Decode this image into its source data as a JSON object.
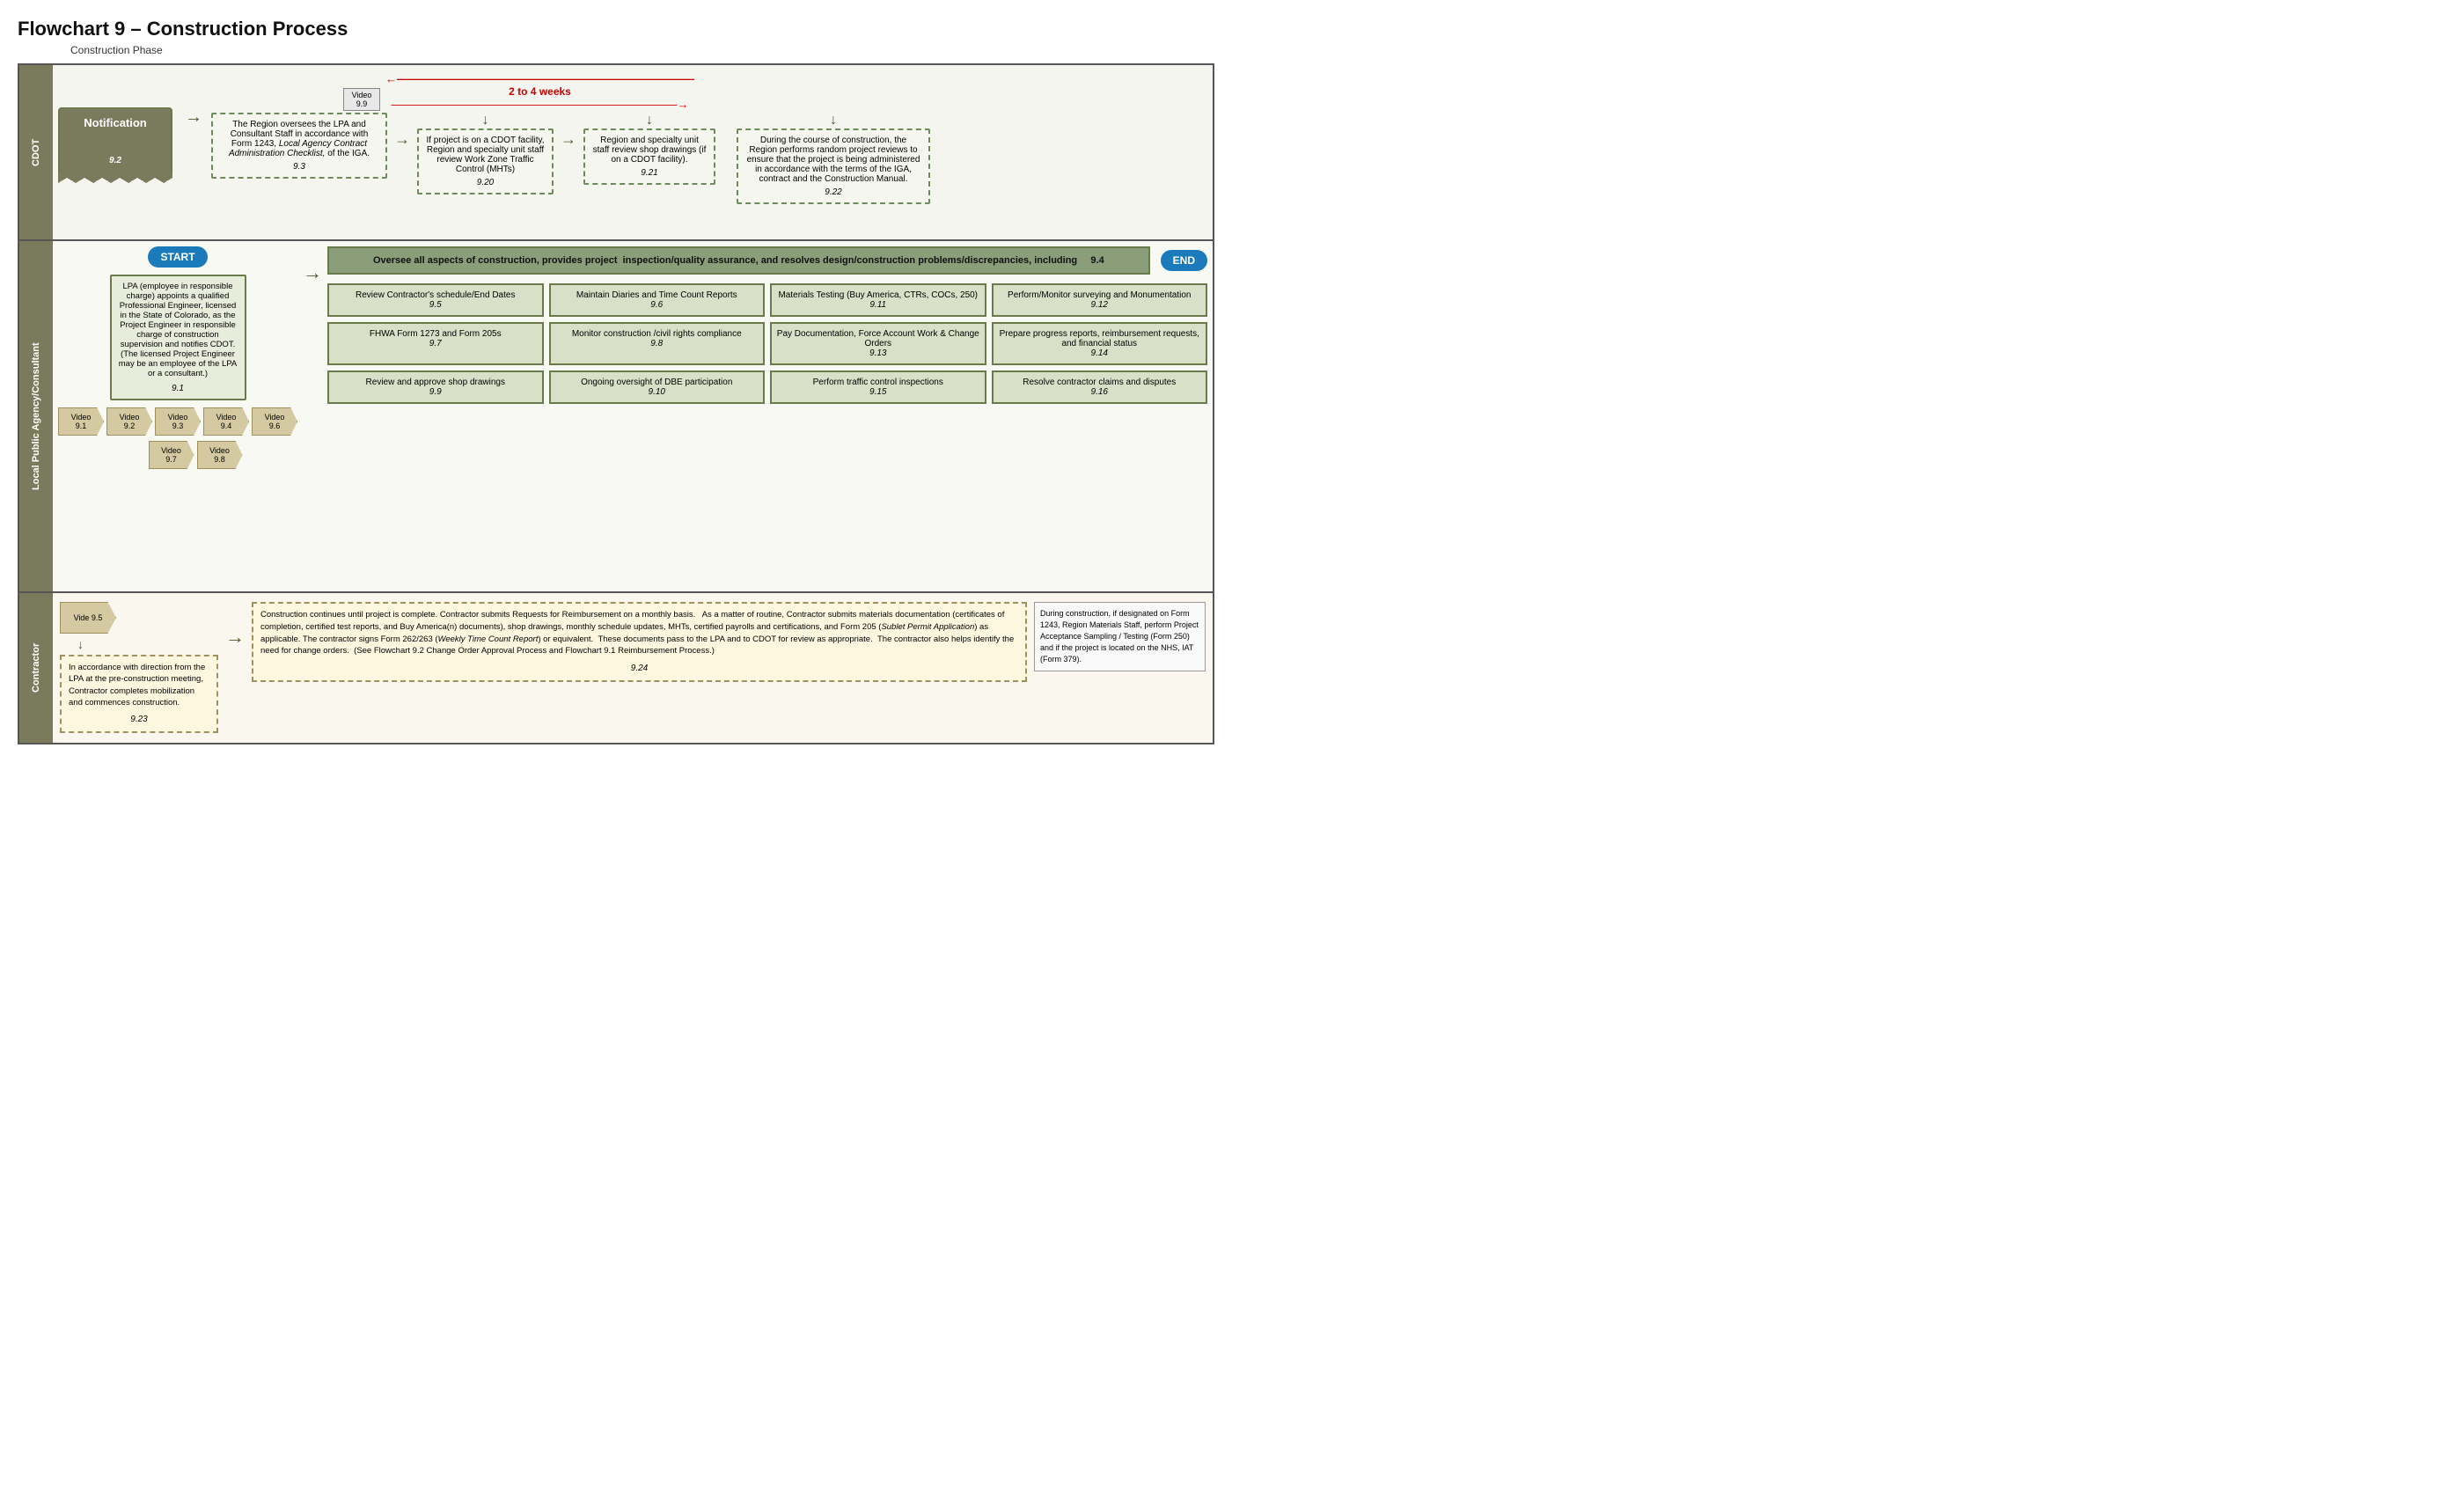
{
  "title": "Flowchart 9 – Construction Process",
  "phase": "Construction Phase",
  "rows": {
    "cdot": {
      "label": "CDOT",
      "notification": {
        "title": "Notification",
        "number": "9.2"
      },
      "video_top": "Video\n9.9",
      "weeks_label": "2 to 4 weeks",
      "box_93": {
        "text": "The Region oversees the LPA and Consultant Staff in accordance with Form 1243, Local Agency Contract Administration Checklist, of the IGA.",
        "number": "9.3",
        "italic_part": "Local Agency Contract Administration Checklist,"
      },
      "box_920": {
        "text": "If project is on a CDOT facility, Region and specialty unit staff review Work Zone Traffic Control (MHTs)",
        "number": "9.20"
      },
      "box_921": {
        "text": "Region and specialty unit staff review shop drawings (if on a CDOT facility).",
        "number": "9.21"
      },
      "box_922": {
        "text": "During the course of construction, the Region performs random project reviews to ensure that the project is being administered in accordance with the terms of the IGA, contract and the Construction Manual.",
        "number": "9.22"
      }
    },
    "lpa": {
      "label": "Local Public Agency/Consultant",
      "start_label": "START",
      "end_label": "END",
      "box_91": {
        "text": "LPA (employee in responsible charge) appoints a qualified Professional Engineer, licensed in the State of Colorado, as the Project Engineer in responsible charge of construction supervision and notifies CDOT.\n(The licensed Project Engineer may be an employee of the LPA or a consultant.)",
        "number": "9.1"
      },
      "videos_left": [
        "Video\n9.1",
        "Video\n9.2",
        "Video\n9.3",
        "Video\n9.4",
        "Video\n9.6"
      ],
      "videos_second_row": [
        "Video\n9.7",
        "Video\n9.8"
      ],
      "oversee_bar": {
        "text": "Oversee all aspects of construction, provides project  inspection/quality assurance, and resolves design/construction problems/discrepancies, including",
        "number": "9.4"
      },
      "tasks": [
        {
          "text": "Review Contractor's schedule/End Dates",
          "number": "9.5"
        },
        {
          "text": "Maintain Diaries and Time Count Reports",
          "number": "9.6"
        },
        {
          "text": "Materials Testing (Buy America, CTRs, COCs, 250)",
          "number": "9.11"
        },
        {
          "text": "Perform/Monitor surveying and Monumentation",
          "number": "9.12"
        },
        {
          "text": "FHWA Form 1273 and Form 205s",
          "number": "9.7"
        },
        {
          "text": "Monitor construction /civil rights compliance",
          "number": "9.8"
        },
        {
          "text": "Pay Documentation, Force Account Work & Change Orders",
          "number": "9.13"
        },
        {
          "text": "Prepare progress reports, reimbursement requests, and financial status",
          "number": "9.14"
        },
        {
          "text": "Review and approve shop drawings",
          "number": "9.9"
        },
        {
          "text": "Ongoing oversight of DBE participation",
          "number": "9.10"
        },
        {
          "text": "Perform traffic control inspections",
          "number": "9.15"
        },
        {
          "text": "Resolve contractor claims and disputes",
          "number": "9.16"
        }
      ]
    },
    "contractor": {
      "label": "Contractor",
      "vide_label": "Vide 9.5",
      "box_923": {
        "text": "In accordance with direction from the LPA at the pre-construction meeting, Contractor completes mobilization and commences construction.",
        "number": "9.23"
      },
      "box_924": {
        "text": "Construction continues until project is complete. Contractor submits Requests for Reimbursement on a monthly basis.   As a matter of routine, Contractor submits materials documentation (certificates of completion, certified test reports, and Buy America(n) documents), shop drawings, monthly schedule updates, MHTs, certified payrolls and certifications, and Form 205 (Sublet Permit Application) as applicable. The contractor signs Form 262/263 (Weekly Time Count Report) or equivalent.  These documents pass to the LPA and to CDOT for review as appropriate.  The contractor also helps identify the need for change orders.  (See Flowchart 9.2 Change Order Approval Process and Flowchart 9.1 Reimbursement Process.)",
        "italic_parts": [
          "Sublet Permit Application",
          "Weekly Time Count Report"
        ],
        "number": "9.24"
      },
      "note": {
        "text": "During construction, if designated on Form 1243, Region Materials Staff, perform Project Acceptance Sampling / Testing (Form 250) and if the project is located on the NHS, IAT (Form 379)."
      }
    }
  }
}
